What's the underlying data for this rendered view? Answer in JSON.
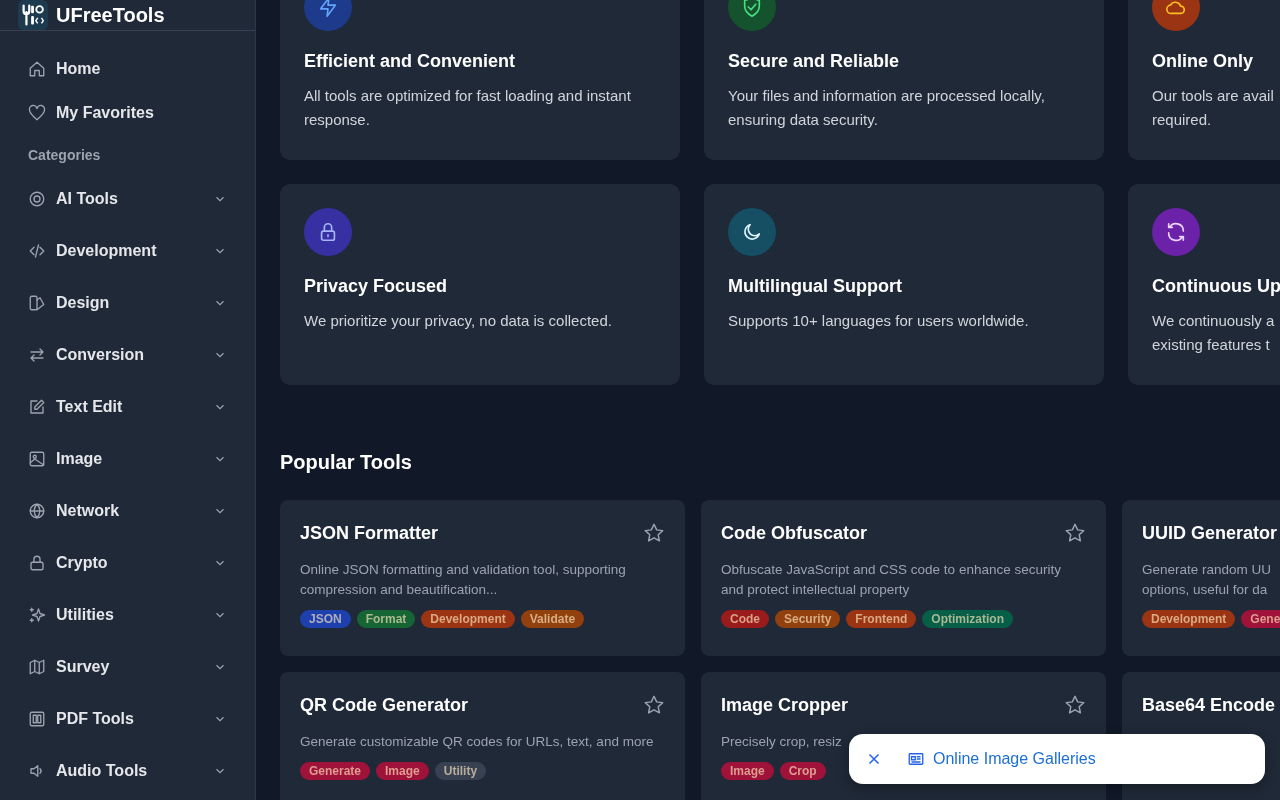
{
  "brand": {
    "name": "UFreeTools"
  },
  "nav": [
    {
      "label": "Home"
    },
    {
      "label": "My Favorites"
    }
  ],
  "categories_heading": "Categories",
  "categories": [
    {
      "label": "AI Tools",
      "expanded": false
    },
    {
      "label": "Development",
      "expanded": false
    },
    {
      "label": "Design",
      "expanded": false
    },
    {
      "label": "Conversion",
      "expanded": false
    },
    {
      "label": "Text Edit",
      "expanded": false
    },
    {
      "label": "Image",
      "expanded": false
    },
    {
      "label": "Network",
      "expanded": false
    },
    {
      "label": "Crypto",
      "expanded": false
    },
    {
      "label": "Utilities",
      "expanded": false
    },
    {
      "label": "Survey",
      "expanded": false
    },
    {
      "label": "PDF Tools",
      "expanded": false
    },
    {
      "label": "Audio Tools",
      "expanded": false
    }
  ],
  "features": [
    {
      "title": "Efficient and Convenient",
      "text": "All tools are optimized for fast loading and instant response.",
      "color": "#1e3a8a"
    },
    {
      "title": "Secure and Reliable",
      "text": "Your files and information are processed locally, ensuring data security.",
      "color": "#14532d"
    },
    {
      "title": "Online Only",
      "text": "Our tools are avail\nrequired.",
      "color": "#9a3412"
    },
    {
      "title": "Privacy Focused",
      "text": "We prioritize your privacy, no data is collected.",
      "color": "#3730a3"
    },
    {
      "title": "Multilingual Support",
      "text": "Supports 10+ languages for users worldwide.",
      "color": "#164e63"
    },
    {
      "title": "Continuous Up",
      "text": "We continuously a\nexisting features t",
      "color": "#6b21a8"
    }
  ],
  "popular": {
    "heading": "Popular Tools",
    "tools": [
      {
        "title": "JSON Formatter",
        "favorite": false,
        "description": "Online JSON formatting and validation tool, supporting compression and beautification...",
        "tags": [
          {
            "label": "JSON",
            "color": "#1e40af"
          },
          {
            "label": "Format",
            "color": "#166534"
          },
          {
            "label": "Development",
            "color": "#9a3412"
          },
          {
            "label": "Validate",
            "color": "#92400e"
          }
        ]
      },
      {
        "title": "Code Obfuscator",
        "favorite": false,
        "description": "Obfuscate JavaScript and CSS code to enhance security and protect intellectual property",
        "tags": [
          {
            "label": "Code",
            "color": "#991b1b"
          },
          {
            "label": "Security",
            "color": "#92400e"
          },
          {
            "label": "Frontend",
            "color": "#9a3412"
          },
          {
            "label": "Optimization",
            "color": "#065f46"
          }
        ]
      },
      {
        "title": "UUID Generator",
        "description": "Generate random UU\noptions, useful for da",
        "tags": [
          {
            "label": "Development",
            "color": "#9a3412"
          },
          {
            "label": "Gene",
            "color": "#9f1239"
          }
        ]
      },
      {
        "title": "QR Code Generator",
        "favorite": false,
        "description": "Generate customizable QR codes for URLs, text, and more",
        "tags": [
          {
            "label": "Generate",
            "color": "#9f1239"
          },
          {
            "label": "Image",
            "color": "#9f1239"
          },
          {
            "label": "Utility",
            "color": "#374151"
          }
        ]
      },
      {
        "title": "Image Cropper",
        "favorite": false,
        "description": "Precisely crop, resiz",
        "tags": [
          {
            "label": "Image",
            "color": "#9f1239"
          },
          {
            "label": "Crop",
            "color": "#9f1239"
          }
        ]
      },
      {
        "title": "Base64 Encode"
      }
    ]
  },
  "toast": {
    "link": "Online Image Galleries"
  }
}
